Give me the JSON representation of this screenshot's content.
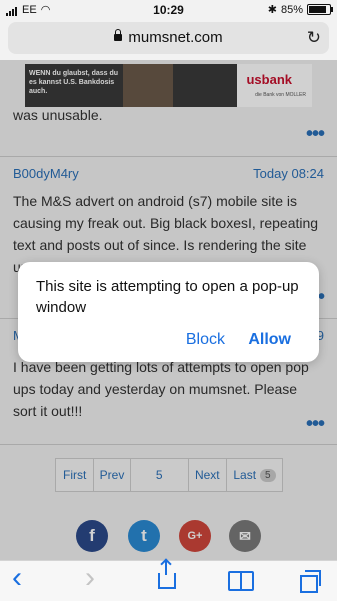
{
  "status_bar": {
    "carrier": "EE",
    "time": "10:29",
    "battery": "85%"
  },
  "browser": {
    "url": "mumsnet.com"
  },
  "ad": {
    "text": "WENN du glaubst, dass du es kannst U.S. Bankdosis auch.",
    "brand": "usbank",
    "brand_sub": "die Bank von MOLLER"
  },
  "posts": [
    {
      "text": "was unusable."
    },
    {
      "author": "B00dyM4ry",
      "date": "Today 08:24",
      "text": "The M&S advert on android (s7) mobile site is causing my freak out. Big black boxesI, repeating text and posts out of since. Is rendering the site unusable on my phone. I'm typing this and my text is"
    },
    {
      "author": "M",
      "date": "9",
      "text": "I have been getting lots of attempts to open pop ups today and yesterday on mumsnet. Please sort it out!!!"
    }
  ],
  "more_icon": "•••",
  "pagination": {
    "first": "First",
    "prev": "Prev",
    "current": "5",
    "next": "Next",
    "last": "Last",
    "last_badge": "5"
  },
  "share": {
    "facebook": "f",
    "twitter": "t",
    "google": "G+",
    "mail": "✉"
  },
  "popup": {
    "message": "This site is attempting to open a pop-up window",
    "block": "Block",
    "allow": "Allow"
  },
  "toolbar": {
    "back": "‹",
    "forward": "›"
  },
  "colors": {
    "link": "#2a6fb7",
    "ios_blue": "#1a6fe0"
  }
}
